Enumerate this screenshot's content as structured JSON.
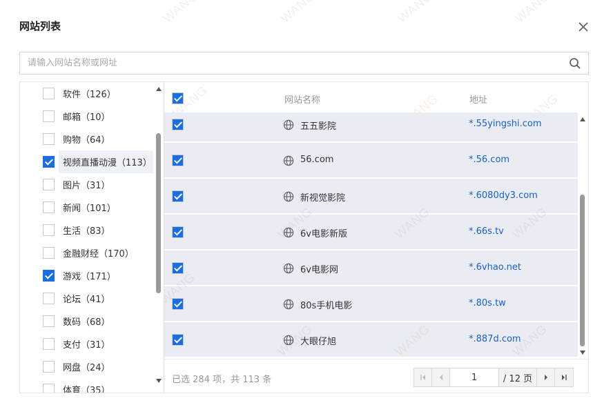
{
  "dialog": {
    "title": "网站列表"
  },
  "search": {
    "placeholder": "请输入网站名称或网址"
  },
  "categories": [
    {
      "label": "软件（126）",
      "checked": false
    },
    {
      "label": "邮箱（10）",
      "checked": false
    },
    {
      "label": "购物（64）",
      "checked": false
    },
    {
      "label": "视频直播动漫（113）",
      "checked": true,
      "selected": true
    },
    {
      "label": "图片（31）",
      "checked": false
    },
    {
      "label": "新闻（101）",
      "checked": false
    },
    {
      "label": "生活（83）",
      "checked": false
    },
    {
      "label": "金融财经（170）",
      "checked": false
    },
    {
      "label": "游戏（171）",
      "checked": true
    },
    {
      "label": "论坛（41）",
      "checked": false
    },
    {
      "label": "数码（68）",
      "checked": false
    },
    {
      "label": "支付（31）",
      "checked": false
    },
    {
      "label": "网盘（24）",
      "checked": false
    },
    {
      "label": "体育（35）",
      "checked": false
    }
  ],
  "table": {
    "headers": {
      "name": "网站名称",
      "address": "地址"
    },
    "rows": [
      {
        "name": "五五影院",
        "address": "*.55yingshi.com",
        "checked": true
      },
      {
        "name": "56.com",
        "address": "*.56.com",
        "checked": true
      },
      {
        "name": "新视觉影院",
        "address": "*.6080dy3.com",
        "checked": true
      },
      {
        "name": "6v电影新版",
        "address": "*.66s.tv",
        "checked": true
      },
      {
        "name": "6v电影网",
        "address": "*.6vhao.net",
        "checked": true
      },
      {
        "name": "80s手机电影",
        "address": "*.80s.tw",
        "checked": true
      },
      {
        "name": "大眼仔旭",
        "address": "*.887d.com",
        "checked": true
      }
    ]
  },
  "footer": {
    "summary": "已选 284 项，共 113 条",
    "page_value": "1",
    "page_total": "/ 12 页"
  },
  "watermark": "WANG",
  "colors": {
    "accent": "#1a6ee0",
    "link": "#1a5fc4",
    "row_bg": "#e9edf3"
  }
}
